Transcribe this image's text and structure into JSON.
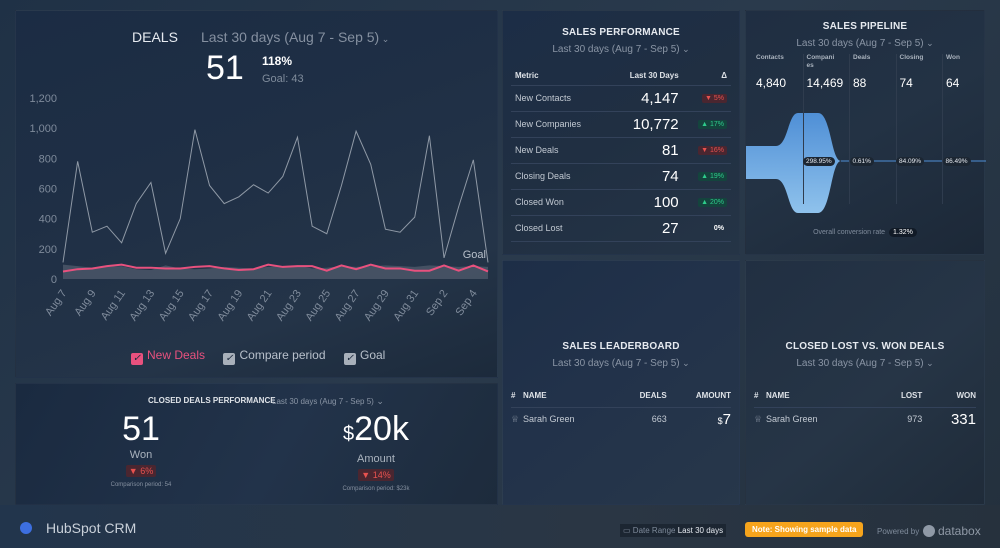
{
  "date_range": "Last 30 days (Aug 7 - Sep 5)",
  "deals": {
    "title": "DEALS",
    "value": "51",
    "pct": "118%",
    "goal": "Goal: 43",
    "goal_label": "Goal",
    "legend": [
      "New Deals",
      "Compare period",
      "Goal"
    ],
    "colors": {
      "new": "#e8517e",
      "compare": "#8f99a6",
      "goal": "#5b6676"
    }
  },
  "chart_data": {
    "type": "line",
    "ylim": [
      0,
      1200
    ],
    "yticks": [
      "0",
      "200",
      "400",
      "600",
      "800",
      "1,000",
      "1,200"
    ],
    "x": [
      "Aug 7",
      "Aug 8",
      "Aug 9",
      "Aug 10",
      "Aug 11",
      "Aug 12",
      "Aug 13",
      "Aug 14",
      "Aug 15",
      "Aug 16",
      "Aug 17",
      "Aug 18",
      "Aug 19",
      "Aug 20",
      "Aug 21",
      "Aug 22",
      "Aug 23",
      "Aug 24",
      "Aug 25",
      "Aug 26",
      "Aug 27",
      "Aug 28",
      "Aug 29",
      "Aug 30",
      "Aug 31",
      "Sep 1",
      "Sep 2",
      "Sep 3",
      "Sep 4",
      "Sep 5"
    ],
    "xtick_labels": [
      "Aug 7",
      "Aug 9",
      "Aug 11",
      "Aug 13",
      "Aug 15",
      "Aug 17",
      "Aug 19",
      "Aug 21",
      "Aug 23",
      "Aug 25",
      "Aug 27",
      "Aug 29",
      "Aug 31",
      "Sep 2",
      "Sep 4"
    ],
    "series": [
      {
        "name": "New Deals",
        "values": [
          50,
          65,
          70,
          85,
          95,
          75,
          75,
          70,
          70,
          80,
          85,
          70,
          60,
          65,
          95,
          80,
          85,
          85,
          55,
          90,
          65,
          95,
          70,
          70,
          55,
          55,
          90,
          55,
          90,
          50
        ]
      },
      {
        "name": "Compare period",
        "values": [
          110,
          780,
          310,
          350,
          240,
          500,
          640,
          170,
          400,
          990,
          620,
          500,
          545,
          625,
          570,
          680,
          940,
          350,
          300,
          620,
          980,
          760,
          330,
          310,
          410,
          950,
          140,
          480,
          790,
          110
        ]
      },
      {
        "name": "Goal",
        "values": [
          95,
          85,
          75,
          80,
          85,
          65,
          60,
          90,
          70,
          65,
          70,
          80,
          75,
          70,
          80,
          85,
          90,
          70,
          75,
          85,
          80,
          85,
          90,
          85,
          80,
          90,
          85,
          80,
          85,
          80
        ]
      }
    ]
  },
  "closed": {
    "title": "CLOSED DEALS PERFORMANCE",
    "won_value": "51",
    "won_label": "Won",
    "won_delta": "▼ 6%",
    "won_cmp": "Comparison period: 54",
    "amount_cur": "$",
    "amount_value": "20k",
    "amount_label": "Amount",
    "amount_delta": "▼ 14%",
    "amount_cmp": "Comparison period: $23k"
  },
  "sales_perf": {
    "title": "SALES PERFORMANCE",
    "headers": [
      "Metric",
      "Last 30 Days",
      "Δ"
    ],
    "rows": [
      {
        "m": "New Contacts",
        "v": "4,147",
        "d": "▼ 5%",
        "t": "dn"
      },
      {
        "m": "New Companies",
        "v": "10,772",
        "d": "▲ 17%",
        "t": "up"
      },
      {
        "m": "New Deals",
        "v": "81",
        "d": "▼ 16%",
        "t": "dn"
      },
      {
        "m": "Closing Deals",
        "v": "74",
        "d": "▲ 19%",
        "t": "up"
      },
      {
        "m": "Closed Won",
        "v": "100",
        "d": "▲ 20%",
        "t": "up"
      },
      {
        "m": "Closed Lost",
        "v": "27",
        "d": "0%",
        "t": ""
      }
    ]
  },
  "pipeline": {
    "title": "SALES PIPELINE",
    "stages": [
      {
        "l": "Contacts",
        "v": "4,840"
      },
      {
        "l": "Compani es",
        "v": "14,469"
      },
      {
        "l": "Deals",
        "v": "88"
      },
      {
        "l": "Closing",
        "v": "74"
      },
      {
        "l": "Won",
        "v": "64"
      }
    ],
    "rates": [
      "298.95%",
      "0.61%",
      "84.09%",
      "86.49%"
    ],
    "overall_label": "Overall conversion rate",
    "overall": "1.32%"
  },
  "leaderboard": {
    "title": "SALES LEADERBOARD",
    "headers": [
      "#",
      "NAME",
      "DEALS",
      "AMOUNT"
    ],
    "row": {
      "name": "Sarah Green",
      "deals": "663",
      "cur": "$",
      "amount": "7"
    }
  },
  "lostwon": {
    "title": "CLOSED LOST VS. WON DEALS",
    "headers": [
      "#",
      "NAME",
      "LOST",
      "WON"
    ],
    "row": {
      "name": "Sarah Green",
      "lost": "973",
      "won": "331"
    }
  },
  "footer": {
    "app": "HubSpot CRM",
    "date_label": "Date Range",
    "date_value": "Last 30 days",
    "note": "Note: Showing sample data",
    "powered": "Powered by",
    "brand": "databox"
  }
}
